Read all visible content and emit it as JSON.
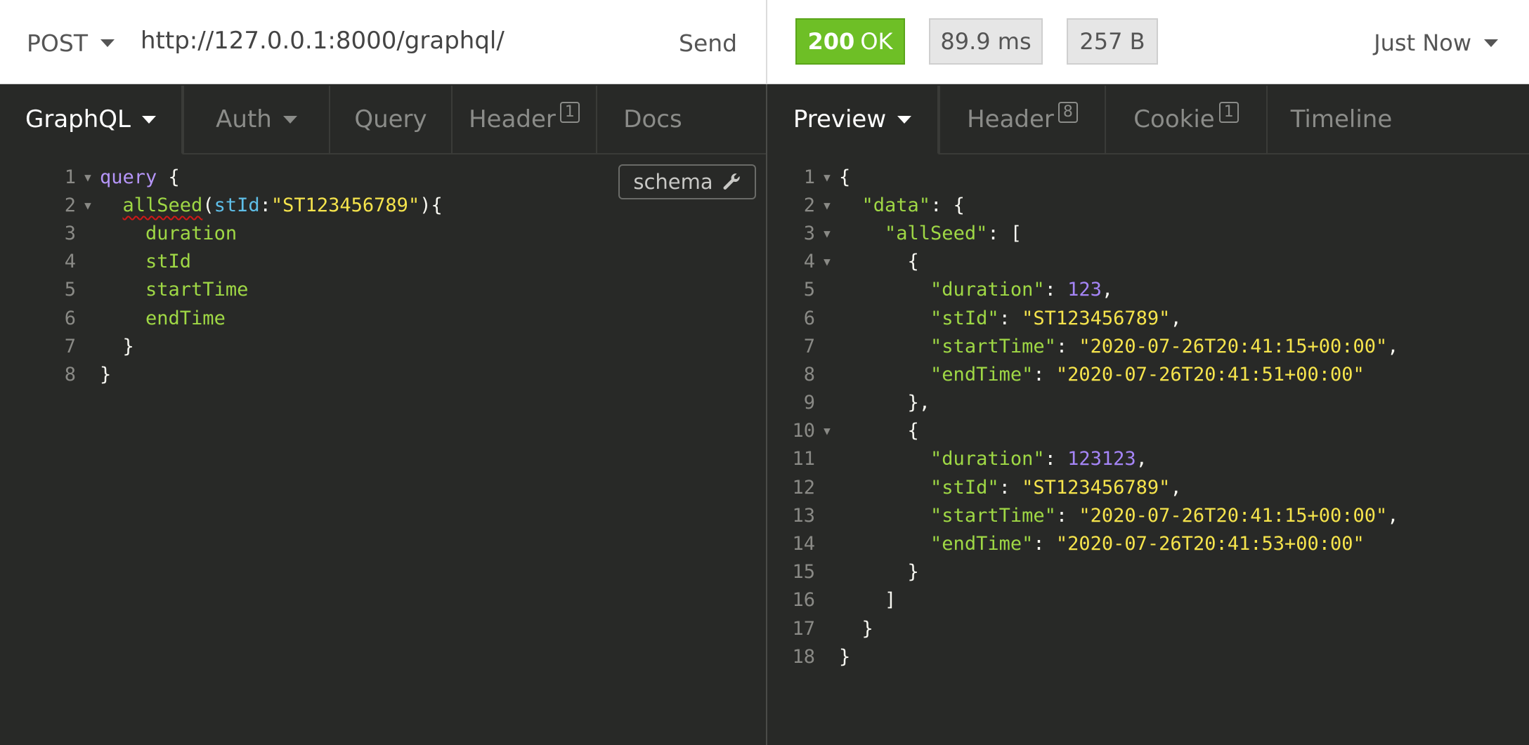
{
  "request": {
    "method": "POST",
    "url": "http://127.0.0.1:8000/graphql/",
    "send_label": "Send"
  },
  "response_meta": {
    "status_code": "200",
    "status_text": "OK",
    "time": "89.9 ms",
    "size": "257 B",
    "history": "Just Now"
  },
  "request_tabs": [
    {
      "label": "GraphQL",
      "active": true
    },
    {
      "label": "Auth"
    },
    {
      "label": "Query"
    },
    {
      "label": "Header",
      "badge": "1"
    },
    {
      "label": "Docs"
    }
  ],
  "response_tabs": [
    {
      "label": "Preview",
      "active": true
    },
    {
      "label": "Header",
      "badge": "8"
    },
    {
      "label": "Cookie",
      "badge": "1"
    },
    {
      "label": "Timeline"
    }
  ],
  "schema_label": "schema",
  "query_editor": {
    "line_numbers": [
      "1",
      "2",
      "3",
      "4",
      "5",
      "6",
      "7",
      "8"
    ],
    "keyword": "query",
    "open_brace": "{",
    "field": "allSeed",
    "arg_name": "stId",
    "arg_value": "\"ST123456789\"",
    "selections": [
      "duration",
      "stId",
      "startTime",
      "endTime"
    ],
    "inner_close": "}",
    "outer_close": "}"
  },
  "response_json": {
    "line_numbers": [
      "1",
      "2",
      "3",
      "4",
      "5",
      "6",
      "7",
      "8",
      "9",
      "10",
      "11",
      "12",
      "13",
      "14",
      "15",
      "16",
      "17",
      "18"
    ],
    "root_key": "\"data\"",
    "list_key": "\"allSeed\"",
    "items": [
      {
        "duration_key": "\"duration\"",
        "duration": "123",
        "stId_key": "\"stId\"",
        "stId": "\"ST123456789\"",
        "startTime_key": "\"startTime\"",
        "startTime": "\"2020-07-26T20:41:15+00:00\"",
        "endTime_key": "\"endTime\"",
        "endTime": "\"2020-07-26T20:41:51+00:00\""
      },
      {
        "duration_key": "\"duration\"",
        "duration": "123123",
        "stId_key": "\"stId\"",
        "stId": "\"ST123456789\"",
        "startTime_key": "\"startTime\"",
        "startTime": "\"2020-07-26T20:41:15+00:00\"",
        "endTime_key": "\"endTime\"",
        "endTime": "\"2020-07-26T20:41:53+00:00\""
      }
    ]
  },
  "colors": {
    "status_ok": "#6ebf26",
    "editor_bg": "#282927",
    "string": "#f6e44c",
    "keyword": "#b595f8",
    "field": "#9fd845",
    "param": "#5fbfe8"
  }
}
